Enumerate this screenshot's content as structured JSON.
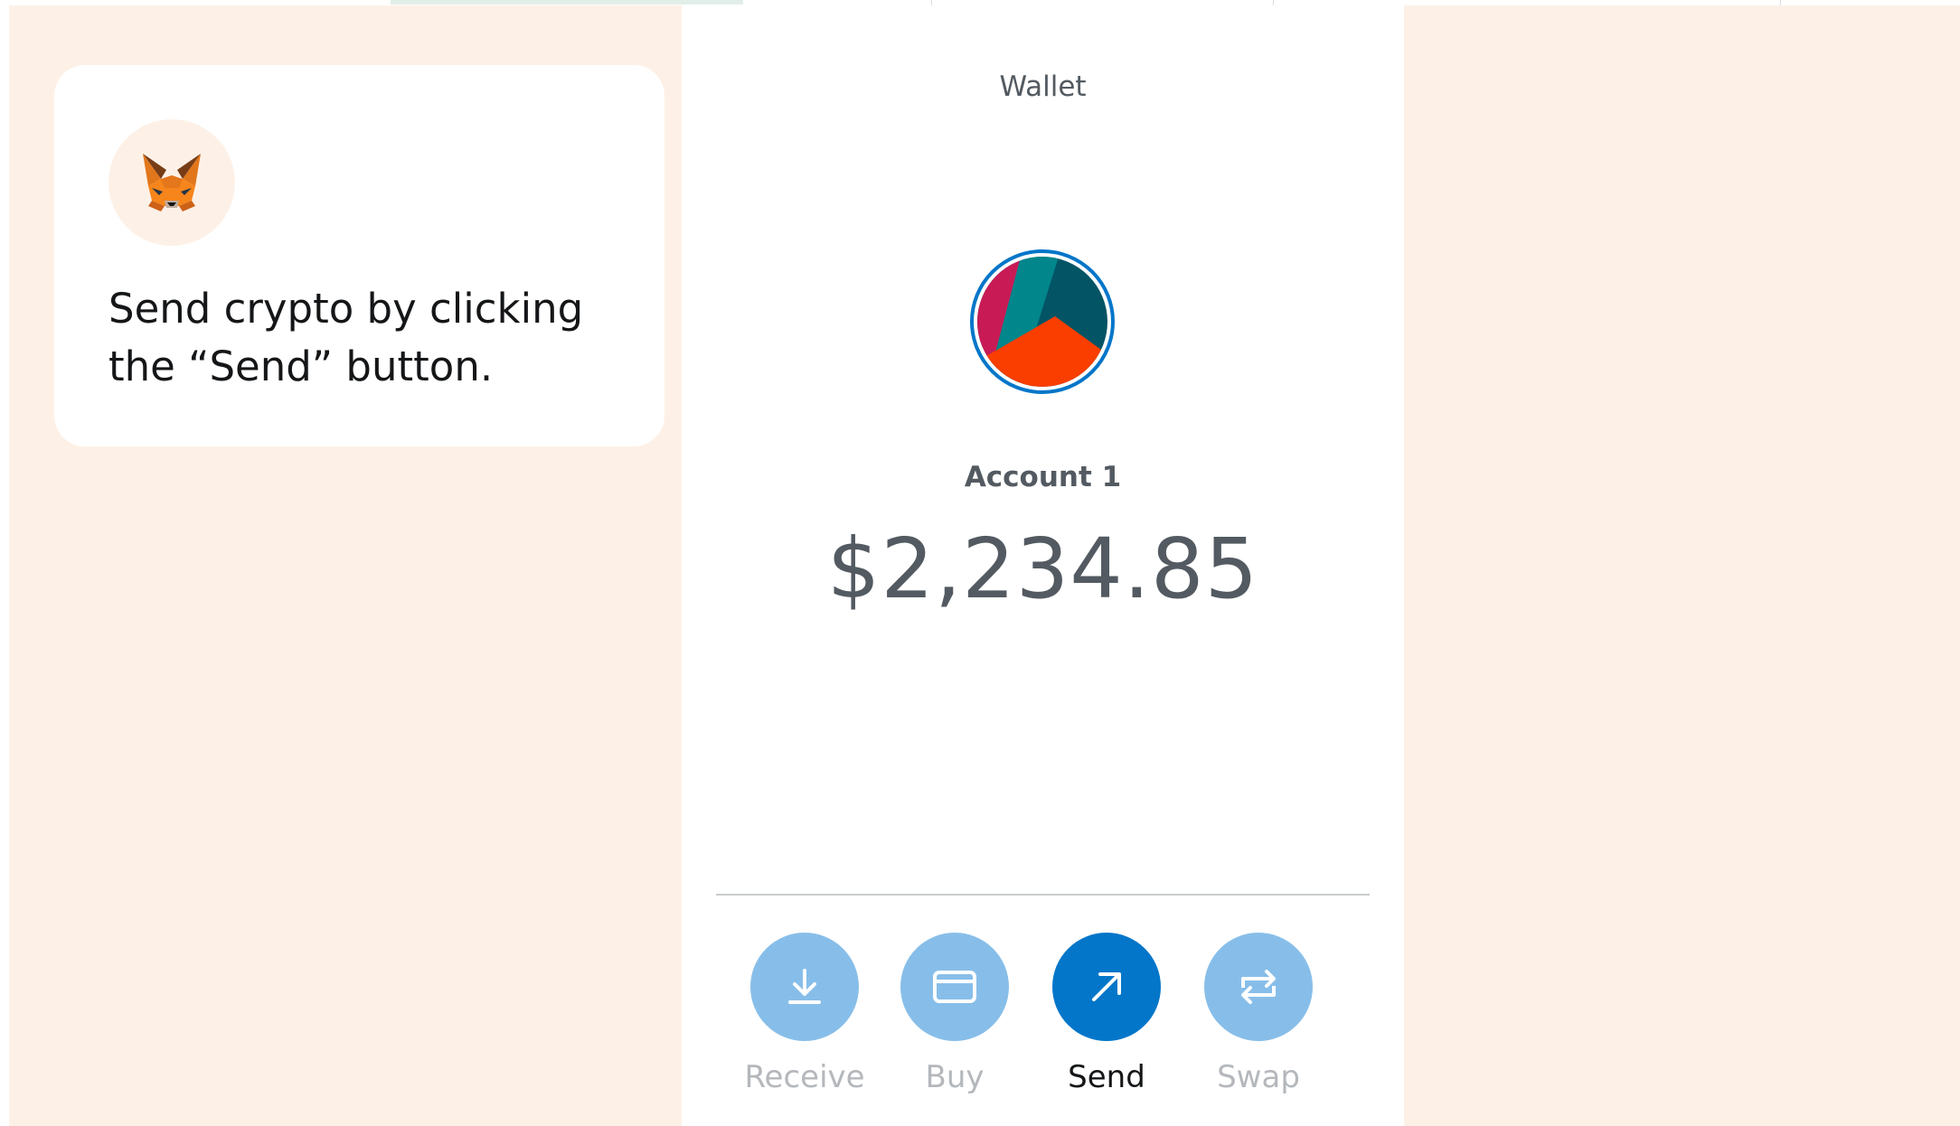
{
  "tooltip": {
    "logo_icon": "metamask-fox-icon",
    "message": "Send crypto by clicking the “Send” button."
  },
  "wallet": {
    "title": "Wallet",
    "avatar_icon": "account-jazzicon",
    "account_name": "Account 1",
    "balance": "$2,234.85"
  },
  "actions": [
    {
      "label": "Receive",
      "icon": "download-icon",
      "active": false
    },
    {
      "label": "Buy",
      "icon": "card-icon",
      "active": false
    },
    {
      "label": "Send",
      "icon": "arrow-up-right-icon",
      "active": true
    },
    {
      "label": "Swap",
      "icon": "swap-arrows-icon",
      "active": false
    }
  ],
  "colors": {
    "accent": "#0376c9",
    "inactive_button": "#87bee9",
    "background": "#fdf1e7",
    "text": "#535a61"
  }
}
